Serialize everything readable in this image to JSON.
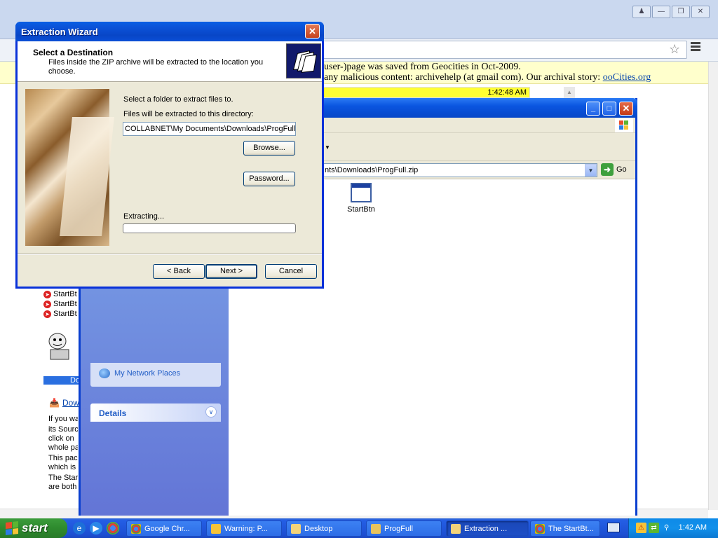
{
  "browser": {
    "banner_text_part1": "user-)page was saved from Geocities in Oct-2009.",
    "banner_text_part2": "any malicious content: archivehelp (at gmail com). Our archival story:",
    "banner_link": "ooCities.org",
    "clock_strip": "1:42:48 AM",
    "menu_icon": "hamburger-menu-icon",
    "star_icon": "bookmark-star-icon"
  },
  "webpage": {
    "list_items": [
      "StartBt",
      "StartBt",
      "StartBt"
    ],
    "bluebar_text": "Do",
    "download_link": "Dow",
    "paragraphs": [
      "If you wa",
      "its Sourc",
      "click on",
      "whole pa",
      "This pac",
      "which is",
      "The Star",
      "are both"
    ]
  },
  "explorer": {
    "address": "nts\\Downloads\\ProgFull.zip",
    "go_label": "Go",
    "file_name": "StartBtn",
    "network_places": "My Network Places",
    "details": "Details"
  },
  "wizard": {
    "title": "Extraction Wizard",
    "heading": "Select a Destination",
    "subtext": "Files inside the ZIP archive will be extracted to the location you choose.",
    "label_select": "Select a folder to extract files to.",
    "label_dir": "Files will be extracted to this directory:",
    "path_value": "COLLABNET\\My Documents\\Downloads\\ProgFull",
    "browse_label": "Browse...",
    "password_label": "Password...",
    "extracting_label": "Extracting...",
    "progress": 0,
    "back_label": "< Back",
    "next_label": "Next >",
    "cancel_label": "Cancel"
  },
  "taskbar": {
    "start_label": "start",
    "tasks": [
      {
        "label": "Google Chr...",
        "icon": "chrome-icon"
      },
      {
        "label": "Warning: P...",
        "icon": "warning-icon"
      },
      {
        "label": "Desktop",
        "icon": "folder-icon"
      },
      {
        "label": "ProgFull",
        "icon": "zip-folder-icon"
      },
      {
        "label": "Extraction ...",
        "icon": "folder-icon"
      },
      {
        "label": "The StartBt...",
        "icon": "chrome-icon"
      }
    ],
    "clock": "1:42 AM"
  },
  "colors": {
    "xp_blue": "#0a55e0",
    "start_green": "#2e8a2e",
    "tray_blue": "#1290ea",
    "banner_yellow": "#ffffcc"
  }
}
